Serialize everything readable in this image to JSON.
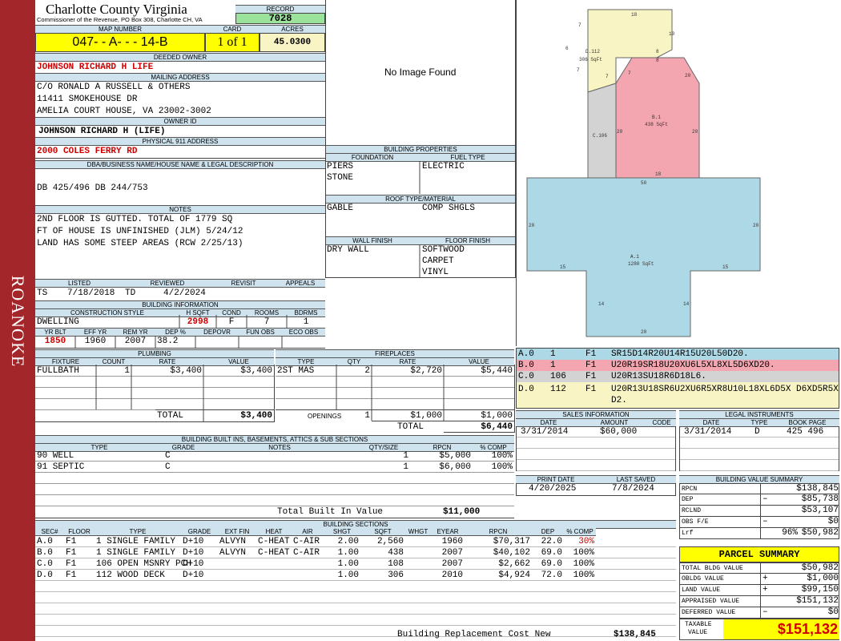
{
  "sidebar": {
    "label": "ROANOKE"
  },
  "header": {
    "county": "Charlotte County Virginia",
    "commissioner": "Commissioner of the Revenue, PO Box 308, Charlotte CH, VA",
    "record_label": "RECORD",
    "record": "7028",
    "map_label": "MAP NUMBER",
    "map_number": "047- - A- - - 14-B",
    "card_label": "CARD",
    "card": "1 of 1",
    "acres_label": "ACRES",
    "acres": "45.0300"
  },
  "owner": {
    "label": "DEEDED OWNER",
    "name": "JOHNSON RICHARD H LIFE",
    "mail_label": "MAILING ADDRESS",
    "mail": [
      "C/O RONALD A RUSSELL & OTHERS",
      "11411 SMOKEHOUSE DR",
      "AMELIA COURT HOUSE, VA 23002-3002"
    ],
    "owner_id_label": "OWNER ID",
    "owner_id": "JOHNSON RICHARD H (LIFE)",
    "addr_label": "PHYSICAL 911 ADDRESS",
    "address": "2000 COLES FERRY RD",
    "legal_label": "DBA/BUSINESS NAME/HOUSE NAME & LEGAL DESCRIPTION",
    "legal": "DB 425/496 DB 244/753",
    "notes_label": "NOTES",
    "notes": [
      "2ND FLOOR IS GUTTED. TOTAL OF 1779 SQ",
      "FT OF HOUSE IS UNFINISHED (JLM) 5/24/12",
      "LAND HAS SOME STEEP AREAS (RCW 2/25/13)"
    ]
  },
  "image": {
    "text": "No Image Found"
  },
  "visits": {
    "listed_label": "LISTED",
    "listed_by": "TS",
    "listed": "7/18/2018",
    "reviewed_label": "REVIEWED",
    "reviewed_by": "TD",
    "reviewed": "4/2/2024",
    "revisit_label": "REVISIT",
    "appeals_label": "APPEALS"
  },
  "building_info": {
    "label": "BUILDING INFORMATION",
    "style_label": "CONSTRUCTION STYLE",
    "style": "DWELLING",
    "hsqft_label": "H SQFT",
    "hsqft": "2998",
    "cond_label": "COND",
    "cond": "F",
    "rooms_label": "ROOMS",
    "rooms": "7",
    "bdrms_label": "BDRMS",
    "bdrms": "1",
    "yrblt_label": "YR BLT",
    "yrblt": "1850",
    "effyr_label": "EFF YR",
    "effyr": "1960",
    "remyr_label": "REM YR",
    "remyr": "2007",
    "dep_label": "DEP %",
    "dep": "38.2",
    "depovr_label": "DEPOVR",
    "funobs_label": "FUN OBS",
    "ecoobs_label": "ECO OBS"
  },
  "properties": {
    "label": "BUILDING PROPERTIES",
    "foundation_label": "FOUNDATION",
    "foundation": [
      "PIERS",
      "STONE"
    ],
    "fuel_label": "FUEL TYPE",
    "fuel": "ELECTRIC",
    "roof_label": "ROOF TYPE/MATERIAL",
    "roof1": "GABLE",
    "roof2": "COMP SHGLS",
    "wall_label": "WALL FINISH",
    "wall": "DRY WALL",
    "floor_label": "FLOOR FINISH",
    "floor": [
      "SOFTWOOD",
      "CARPET",
      "VINYL"
    ]
  },
  "plumbing": {
    "label": "PLUMBING",
    "cols": [
      "FIXTURE",
      "COUNT",
      "RATE",
      "VALUE"
    ],
    "rows": [
      [
        "FULLBATH",
        "1",
        "$3,400",
        "$3,400"
      ]
    ],
    "total_label": "TOTAL",
    "total": "$3,400"
  },
  "fireplaces": {
    "label": "FIREPLACES",
    "cols": [
      "TYPE",
      "QTY",
      "RATE",
      "VALUE"
    ],
    "rows": [
      [
        "2ST MAS",
        "2",
        "$2,720",
        "$5,440"
      ]
    ],
    "openings_label": "OPENINGS",
    "openings_qty": "1",
    "openings_rate": "$1,000",
    "openings_value": "$1,000",
    "total_label": "TOTAL",
    "total": "$6,440"
  },
  "builtins": {
    "label": "BUILDING BUILT INS, BASEMENTS, ATTICS & SUB SECTIONS",
    "cols": [
      "TYPE",
      "GRADE",
      "NOTES",
      "QTY/SIZE",
      "RPCN",
      "% COMP"
    ],
    "rows": [
      [
        "90 WELL",
        "C",
        "",
        "1",
        "$5,000",
        "100%"
      ],
      [
        "91 SEPTIC",
        "C",
        "",
        "1",
        "$6,000",
        "100%"
      ]
    ],
    "total_label": "Total Built In Value",
    "total": "$11,000"
  },
  "sections": {
    "label": "BUILDING SECTIONS",
    "cols": [
      "SEC#",
      "FLOOR",
      "TYPE",
      "GRADE",
      "EXT FIN",
      "HEAT",
      "AIR",
      "SHGT",
      "SQFT",
      "WHGT",
      "EYEAR",
      "RPCN",
      "DEP",
      "% COMP"
    ],
    "rows": [
      [
        "A.0",
        "F1",
        "1 SINGLE FAMILY",
        "D+10",
        "ALVYN",
        "C-HEAT",
        "C-AIR",
        "2.00",
        "2,560",
        "",
        "1960",
        "$70,317",
        "22.0",
        "30%"
      ],
      [
        "B.0",
        "F1",
        "1 SINGLE FAMILY",
        "D+10",
        "ALVYN",
        "C-HEAT",
        "C-AIR",
        "1.00",
        "438",
        "",
        "2007",
        "$40,102",
        "69.0",
        "100%"
      ],
      [
        "C.0",
        "F1",
        "106 OPEN MSNRY PCH",
        "D+10",
        "",
        "",
        "",
        "1.00",
        "108",
        "",
        "2007",
        "$2,662",
        "69.0",
        "100%"
      ],
      [
        "D.0",
        "F1",
        "112 WOOD DECK",
        "D+10",
        "",
        "",
        "",
        "1.00",
        "306",
        "",
        "2010",
        "$4,924",
        "72.0",
        "100%"
      ]
    ],
    "total_label": "Building Replacement Cost New",
    "total": "$138,845"
  },
  "sketch": {
    "labels": [
      {
        "id": "D.112",
        "sqft": "306 SqFt"
      },
      {
        "id": "B.1",
        "sqft": "438 SqFt"
      },
      {
        "id": "C.106",
        "sqft": ""
      },
      {
        "id": "A.1",
        "sqft": "1280 SqFt"
      }
    ],
    "dims": [
      "18",
      "10",
      "7",
      "6",
      "7",
      "8",
      "8",
      "7",
      "7",
      "20",
      "20",
      "20",
      "18",
      "50",
      "20",
      "20",
      "15",
      "15",
      "14",
      "14",
      "20"
    ]
  },
  "sketch_codes": [
    [
      "A.0",
      "1",
      "F1",
      "SR15D14R20U14R15U20L50D20."
    ],
    [
      "B.0",
      "1",
      "F1",
      "U20R19SR18U20XU6L5XL8XL5D6XD20."
    ],
    [
      "C.0",
      "106",
      "F1",
      "U20R13SU18R6D18L6."
    ],
    [
      "D.0",
      "112",
      "F1",
      "U20R13U18SR6U2XU6R5XR8U10L18XL6D5X D6XD5R5XD2."
    ]
  ],
  "colors": {
    "A": "#add8e6",
    "B": "#f4a6b0",
    "C": "#d3d3d3",
    "D": "#f8f4c4",
    "sidebar": "#a3262a",
    "header": "#cfe3ef",
    "yellow": "#ffff00",
    "record": "#9be39b"
  },
  "sales": {
    "label": "SALES INFORMATION",
    "cols": [
      "DATE",
      "AMOUNT",
      "CODE"
    ],
    "rows": [
      [
        "3/31/2014",
        "$60,000",
        ""
      ]
    ]
  },
  "legal_inst": {
    "label": "LEGAL INSTRUMENTS",
    "cols": [
      "DATE",
      "TYPE",
      "BOOK PAGE"
    ],
    "rows": [
      [
        "3/31/2014",
        "D",
        "425 496"
      ]
    ]
  },
  "print": {
    "print_label": "PRINT DATE",
    "print_date": "4/20/2025",
    "saved_label": "LAST SAVED",
    "saved": "7/8/2024"
  },
  "value_summary": {
    "label": "BUILDING VALUE SUMMARY",
    "rows": [
      [
        "RPCN",
        "",
        "$138,845"
      ],
      [
        "DEP",
        "–",
        "$85,738"
      ],
      [
        "RCLND",
        "",
        "$53,107"
      ],
      [
        "OBS F/E",
        "–",
        "$0"
      ],
      [
        "Lrf",
        "96%",
        "$50,982"
      ]
    ]
  },
  "parcel": {
    "label": "PARCEL SUMMARY",
    "rows": [
      [
        "TOTAL BLDG VALUE",
        "",
        "$50,982"
      ],
      [
        "OBLDG VALUE",
        "+",
        "$1,000"
      ],
      [
        "LAND VALUE",
        "+",
        "$99,150"
      ],
      [
        "APPRAISED VALUE",
        "",
        "$151,132"
      ],
      [
        "DEFERRED VALUE",
        "–",
        "$0"
      ]
    ],
    "taxable_label1": "TAXABLE",
    "taxable_label2": "VALUE",
    "taxable": "$151,132"
  }
}
